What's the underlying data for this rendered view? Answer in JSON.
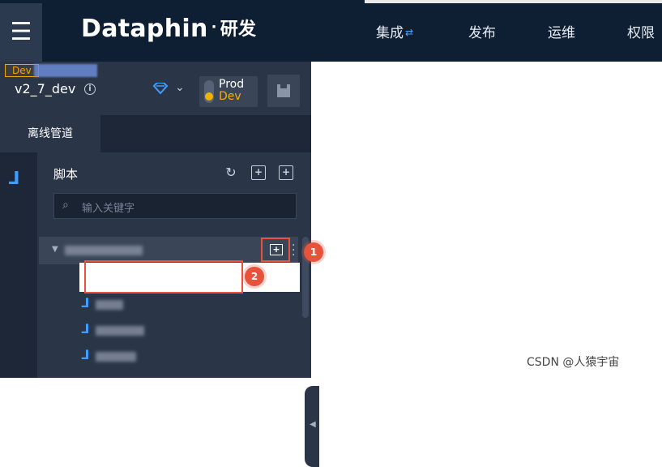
{
  "header": {
    "menu_icon": "hamburger-icon",
    "brand": "Dataphin",
    "brand_sep": "·",
    "brand_sub": "研发",
    "nav": [
      {
        "label": "集成",
        "icon": "swap-arrows-icon"
      },
      {
        "label": "发布"
      },
      {
        "label": "运维"
      },
      {
        "label": "权限"
      }
    ]
  },
  "toolbar": {
    "env_badge": "Dev",
    "project": "v2_7_dev",
    "env_prod": "Prod",
    "env_dev": "Dev"
  },
  "tabs": [
    {
      "label": "离线管道"
    }
  ],
  "panel": {
    "title": "脚本",
    "search_placeholder": "输入关键字"
  },
  "annotations": {
    "marker1": "1",
    "marker2": "2"
  },
  "watermark": "CSDN @人猿宇宙",
  "colors": {
    "accent": "#3d9eff",
    "highlight": "#e8513a",
    "dev": "#f0b400",
    "header": "#0f1f33",
    "sidebar": "#2a3548"
  }
}
